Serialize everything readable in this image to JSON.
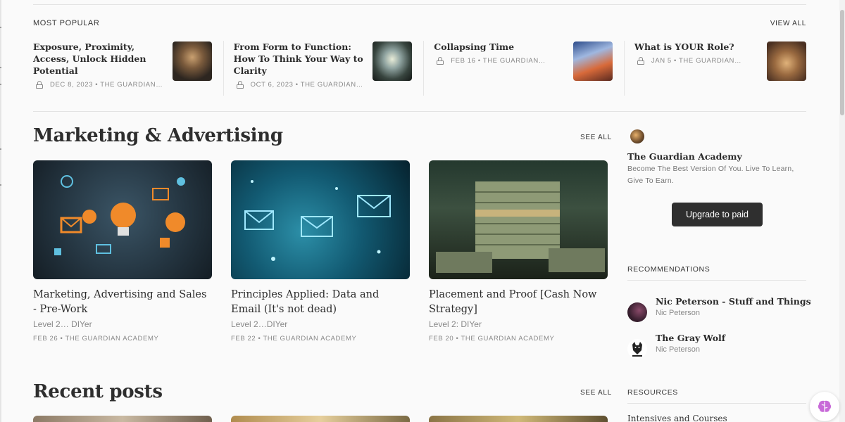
{
  "colors": {
    "accent_button": "#2f2f2f",
    "text": "#2b2b2b",
    "muted": "#888888",
    "background": "#fafafa"
  },
  "most_popular": {
    "label": "MOST POPULAR",
    "view_all": "VIEW ALL",
    "items": [
      {
        "title": "Exposure, Proximity, Access, Unlock Hidden Potential",
        "meta": "DEC 8, 2023 • THE GUARDIAN…",
        "icon": "lock-icon"
      },
      {
        "title": "From Form to Function: How To Think Your Way to Clarity",
        "meta": "OCT 6, 2023 • THE GUARDIAN…",
        "icon": "lock-icon"
      },
      {
        "title": "Collapsing Time",
        "meta": "FEB 16 • THE GUARDIAN…",
        "icon": "lock-icon"
      },
      {
        "title": "What is YOUR Role?",
        "meta": "JAN 5 • THE GUARDIAN…",
        "icon": "lock-icon"
      }
    ]
  },
  "marketing": {
    "title": "Marketing & Advertising",
    "see_all": "SEE ALL",
    "cards": [
      {
        "title": "Marketing, Advertising and Sales - Pre-Work",
        "subtitle": "Level 2… DIYer",
        "meta": "FEB 26 • THE GUARDIAN ACADEMY"
      },
      {
        "title": "Principles Applied: Data and Email (It's not dead)",
        "subtitle": "Level 2…DIYer",
        "meta": "FEB 22 • THE GUARDIAN ACADEMY"
      },
      {
        "title": "Placement and Proof [Cash Now Strategy]",
        "subtitle": "Level 2: DIYer",
        "meta": "FEB 20 • THE GUARDIAN ACADEMY"
      }
    ]
  },
  "recent": {
    "title": "Recent posts",
    "see_all": "SEE ALL"
  },
  "sidebar": {
    "pub_name": "The Guardian Academy",
    "pub_desc": "Become The Best Version Of You. Live To Learn, Give To Earn.",
    "upgrade": "Upgrade to paid",
    "recommendations_label": "RECOMMENDATIONS",
    "recommendations": [
      {
        "name": "Nic Peterson - Stuff and Things",
        "author": "Nic Peterson"
      },
      {
        "name": "The Gray Wolf",
        "author": "Nic Peterson"
      }
    ],
    "resources_label": "RESOURCES",
    "resources_first": "Intensives and Courses"
  }
}
